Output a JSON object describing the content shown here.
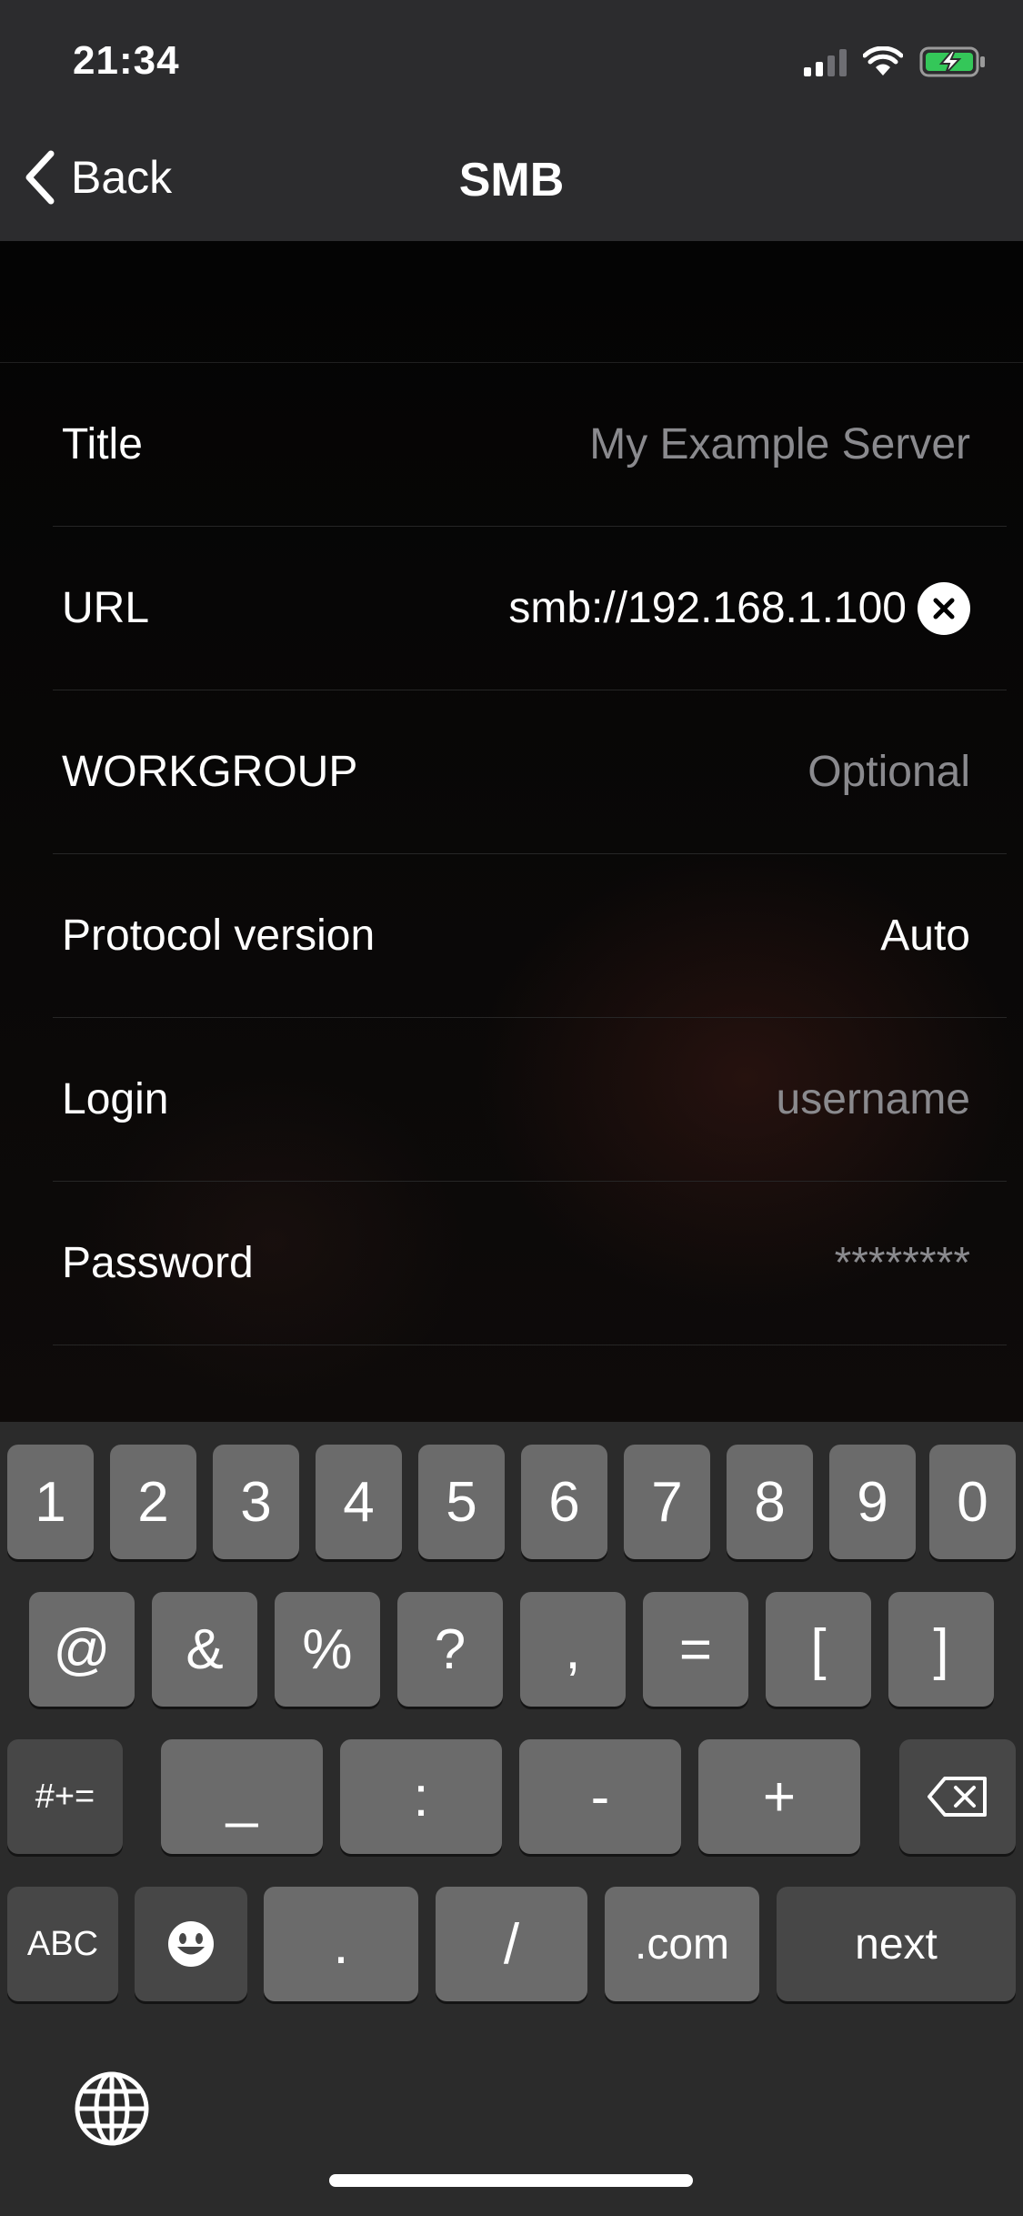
{
  "status_bar": {
    "time": "21:34"
  },
  "nav": {
    "back_label": "Back",
    "title": "SMB"
  },
  "form": {
    "title": {
      "label": "Title",
      "placeholder": "My Example Server"
    },
    "url": {
      "label": "URL",
      "value": "smb://192.168.1.100"
    },
    "workgroup": {
      "label": "WORKGROUP",
      "placeholder": "Optional"
    },
    "protocol": {
      "label": "Protocol version",
      "value": "Auto"
    },
    "login": {
      "label": "Login",
      "placeholder": "username"
    },
    "password": {
      "label": "Password",
      "placeholder": "********"
    }
  },
  "keyboard": {
    "row1": [
      "1",
      "2",
      "3",
      "4",
      "5",
      "6",
      "7",
      "8",
      "9",
      "0"
    ],
    "row2": [
      "@",
      "&",
      "%",
      "?",
      ",",
      "=",
      "[",
      "]"
    ],
    "row3": {
      "shift": "#+=",
      "keys": [
        "_",
        ":",
        "-",
        "+"
      ]
    },
    "row4": {
      "abc": "ABC",
      "period": ".",
      "slash": "/",
      "dotcom": ".com",
      "next": "next"
    }
  },
  "colors": {
    "header_bg": "#2c2c2e",
    "battery_green": "#34c759",
    "placeholder": "#8a8a8e"
  }
}
